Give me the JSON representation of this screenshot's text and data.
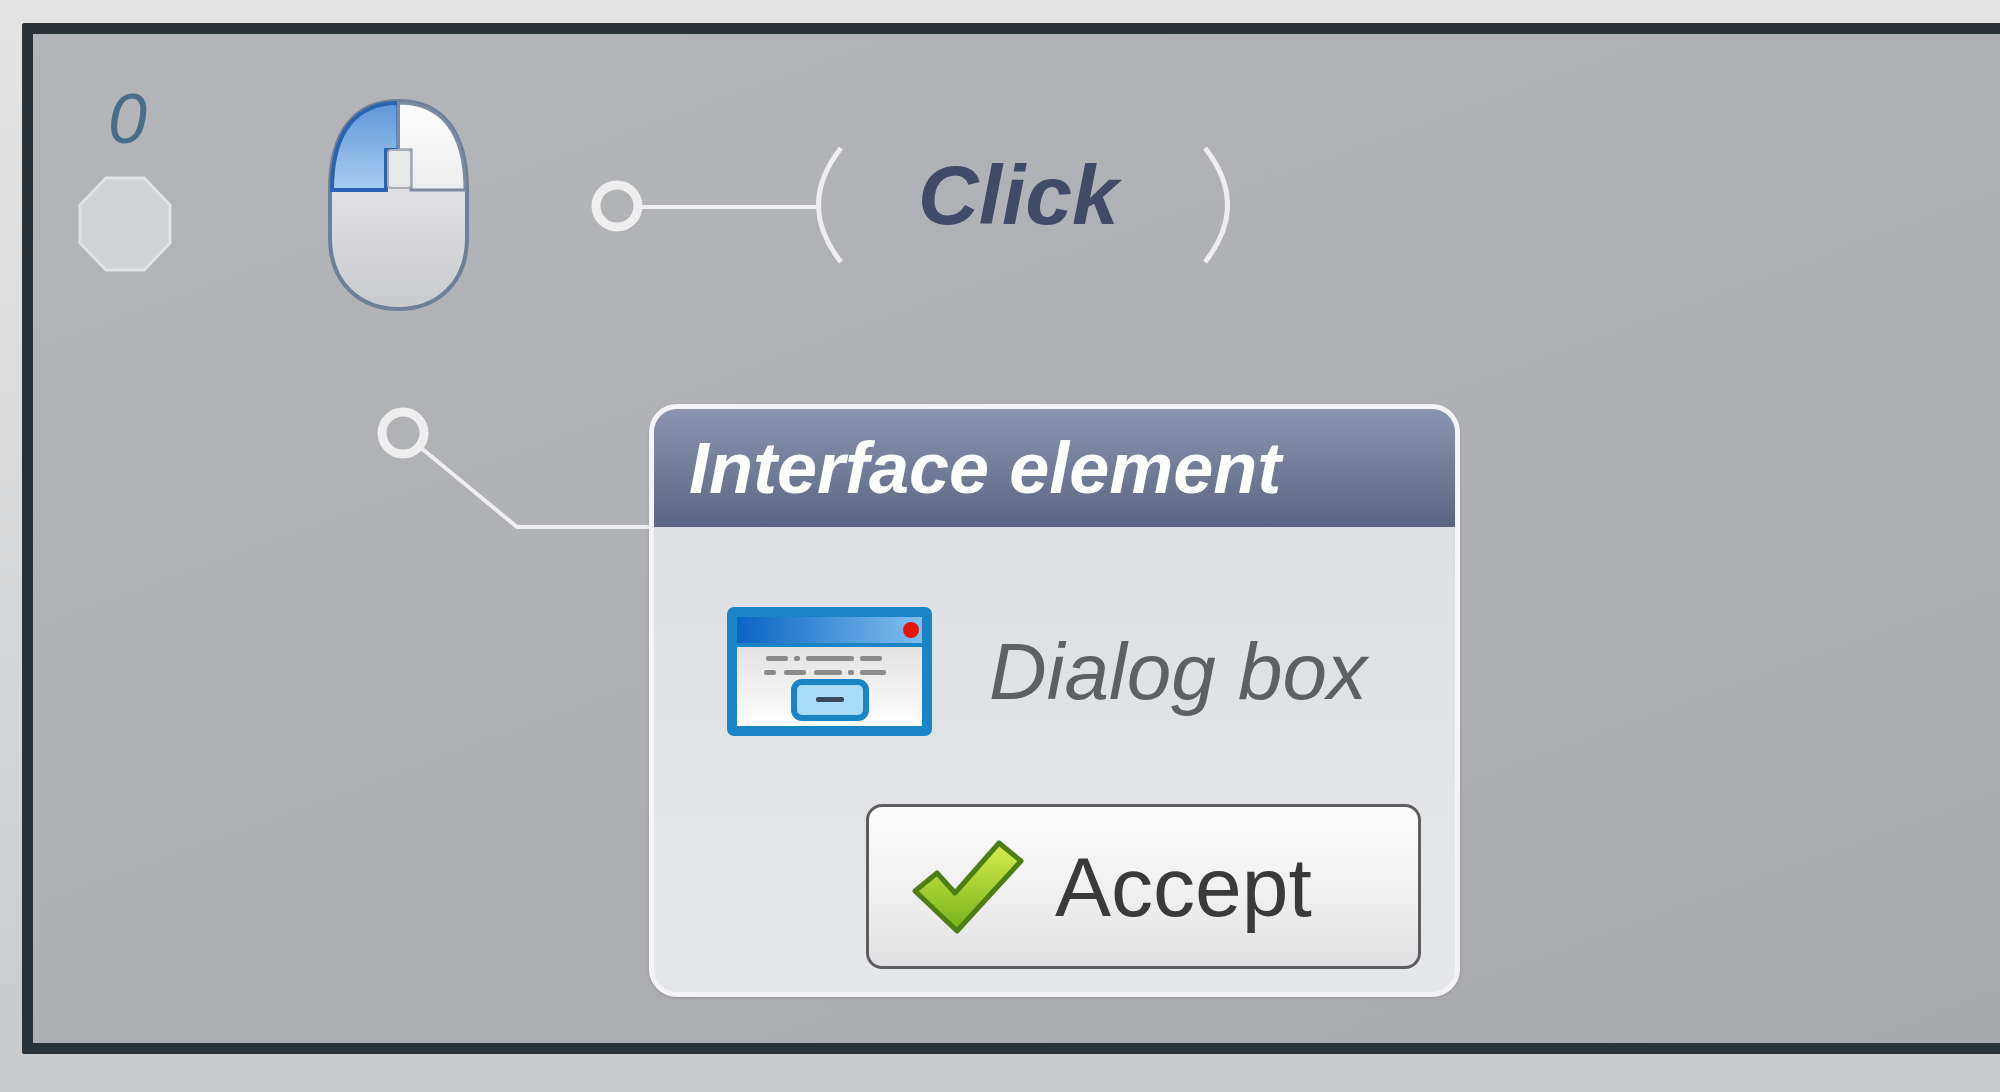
{
  "step": {
    "number": "0",
    "trigger": {
      "action": "Click",
      "left_button_pressed": true,
      "right_button_pressed": false
    },
    "element": {
      "header": "Interface element",
      "name": "Dialog box",
      "button": {
        "label": "Accept"
      }
    }
  }
}
